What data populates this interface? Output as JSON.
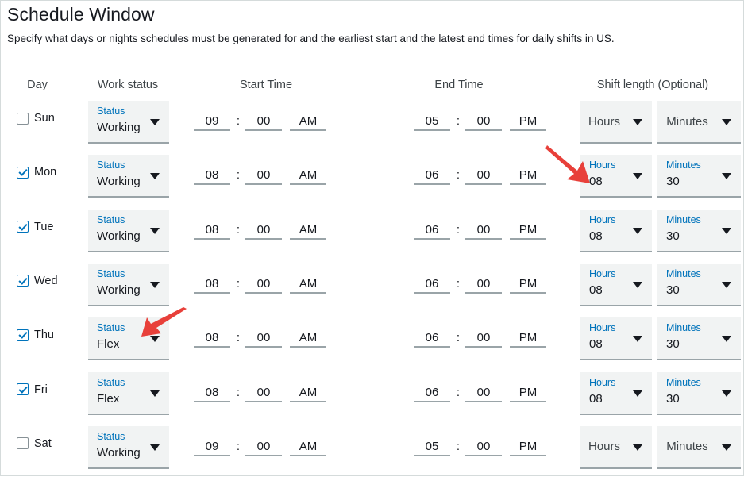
{
  "header": {
    "title": "Schedule Window",
    "subtitle": "Specify what days or nights schedules must be generated for and the earliest start and the latest end times for daily shifts in US."
  },
  "columns": {
    "day": "Day",
    "work_status": "Work status",
    "start_time": "Start Time",
    "end_time": "End Time",
    "shift_length": "Shift length (Optional)"
  },
  "labels": {
    "status": "Status",
    "hours": "Hours",
    "minutes": "Minutes",
    "colon": ":"
  },
  "colors": {
    "accent_blue": "#0073bb",
    "field_bg": "#f1f3f3",
    "text": "#16191f",
    "arrow_red": "#e8403a"
  },
  "rows": [
    {
      "day": "Sun",
      "checked": false,
      "status_label": "Status",
      "status_value": "Working",
      "start": {
        "hh": "09",
        "mm": "00",
        "ampm": "AM"
      },
      "end": {
        "hh": "05",
        "mm": "00",
        "ampm": "PM"
      },
      "hours_label": "Hours",
      "hours_value": "",
      "minutes_label": "Minutes",
      "minutes_value": ""
    },
    {
      "day": "Mon",
      "checked": true,
      "status_label": "Status",
      "status_value": "Working",
      "start": {
        "hh": "08",
        "mm": "00",
        "ampm": "AM"
      },
      "end": {
        "hh": "06",
        "mm": "00",
        "ampm": "PM"
      },
      "hours_label": "Hours",
      "hours_value": "08",
      "minutes_label": "Minutes",
      "minutes_value": "30"
    },
    {
      "day": "Tue",
      "checked": true,
      "status_label": "Status",
      "status_value": "Working",
      "start": {
        "hh": "08",
        "mm": "00",
        "ampm": "AM"
      },
      "end": {
        "hh": "06",
        "mm": "00",
        "ampm": "PM"
      },
      "hours_label": "Hours",
      "hours_value": "08",
      "minutes_label": "Minutes",
      "minutes_value": "30"
    },
    {
      "day": "Wed",
      "checked": true,
      "status_label": "Status",
      "status_value": "Working",
      "start": {
        "hh": "08",
        "mm": "00",
        "ampm": "AM"
      },
      "end": {
        "hh": "06",
        "mm": "00",
        "ampm": "PM"
      },
      "hours_label": "Hours",
      "hours_value": "08",
      "minutes_label": "Minutes",
      "minutes_value": "30"
    },
    {
      "day": "Thu",
      "checked": true,
      "status_label": "Status",
      "status_value": "Flex",
      "start": {
        "hh": "08",
        "mm": "00",
        "ampm": "AM"
      },
      "end": {
        "hh": "06",
        "mm": "00",
        "ampm": "PM"
      },
      "hours_label": "Hours",
      "hours_value": "08",
      "minutes_label": "Minutes",
      "minutes_value": "30"
    },
    {
      "day": "Fri",
      "checked": true,
      "status_label": "Status",
      "status_value": "Flex",
      "start": {
        "hh": "08",
        "mm": "00",
        "ampm": "AM"
      },
      "end": {
        "hh": "06",
        "mm": "00",
        "ampm": "PM"
      },
      "hours_label": "Hours",
      "hours_value": "08",
      "minutes_label": "Minutes",
      "minutes_value": "30"
    },
    {
      "day": "Sat",
      "checked": false,
      "status_label": "Status",
      "status_value": "Working",
      "start": {
        "hh": "09",
        "mm": "00",
        "ampm": "AM"
      },
      "end": {
        "hh": "05",
        "mm": "00",
        "ampm": "PM"
      },
      "hours_label": "Hours",
      "hours_value": "",
      "minutes_label": "Minutes",
      "minutes_value": ""
    }
  ],
  "annotations": [
    {
      "name": "arrow-pointing-to-shift-hours",
      "target": "Mon shift length Hours dropdown"
    },
    {
      "name": "arrow-pointing-to-status-dropdown",
      "target": "Thu work status dropdown"
    }
  ]
}
